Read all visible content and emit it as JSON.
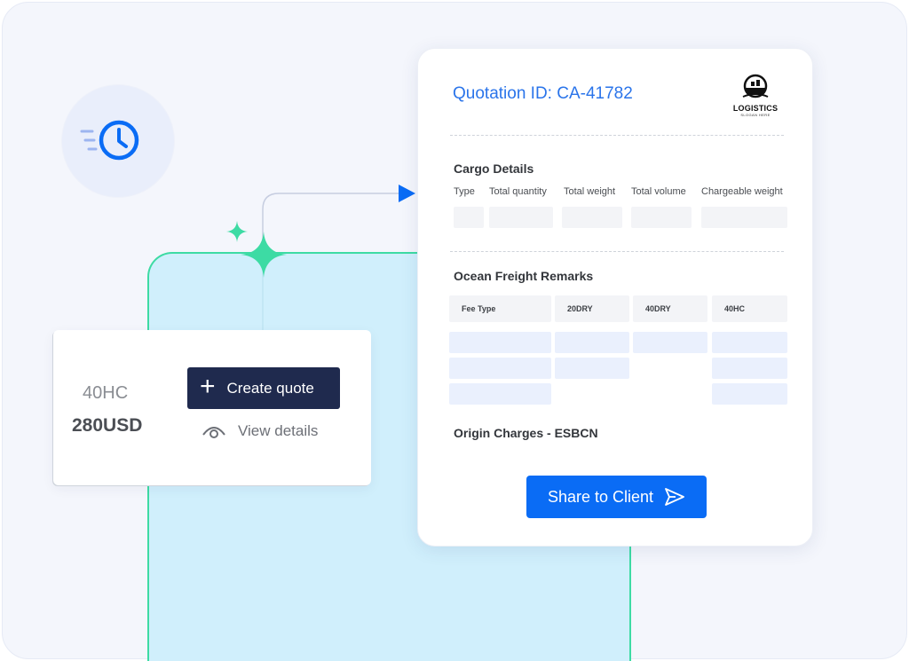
{
  "colors": {
    "accent_blue": "#0a6cf5",
    "title_blue": "#2a74ea",
    "dark_button": "#1f2a4e",
    "mint": "#3ddba4",
    "panel_blue": "#d0effc"
  },
  "icons": {
    "clock": "clock-icon",
    "sparkle": "sparkle-icon",
    "plus": "plus-icon",
    "eye": "eye-icon",
    "send": "send-icon",
    "logo": "ship-logo-icon"
  },
  "quote_card": {
    "container_type": "40HC",
    "price": "280USD",
    "create_label": "Create quote",
    "plus_glyph": "+",
    "view_label": "View details"
  },
  "quotation": {
    "title": "Quotation ID: CA-41782",
    "logo_name": "LOGISTICS",
    "logo_slogan": "SLOGAN HERE",
    "cargo_title": "Cargo Details",
    "cargo_columns": [
      "Type",
      "Total quantity",
      "Total weight",
      "Total volume",
      "Chargeable weight"
    ],
    "ocean_title": "Ocean Freight Remarks",
    "fee_columns": [
      "Fee Type",
      "20DRY",
      "40DRY",
      "40HC"
    ],
    "origin_title": "Origin Charges - ESBCN",
    "share_label": "Share to Client"
  }
}
